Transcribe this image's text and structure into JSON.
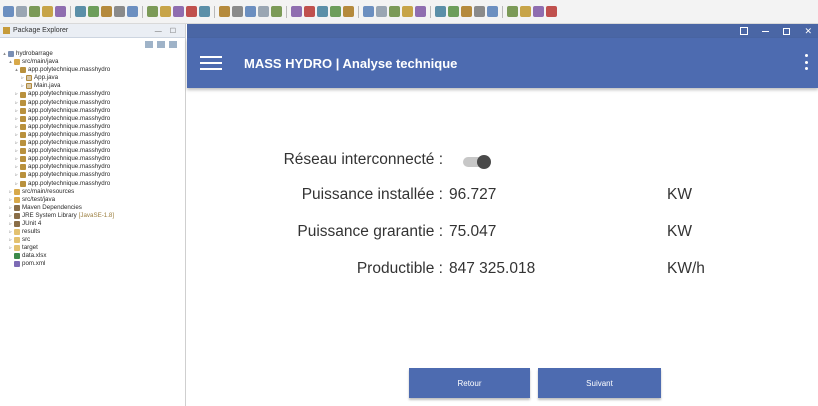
{
  "explorer": {
    "tab_label": "Package Explorer",
    "tab_suffix": "✕✕",
    "tree": [
      {
        "depth": 0,
        "twist": "▴",
        "icon": "project",
        "label": "hydrobarrage"
      },
      {
        "depth": 1,
        "twist": "▴",
        "icon": "srcfolder",
        "label": "src/main/java"
      },
      {
        "depth": 2,
        "twist": "▴",
        "icon": "package",
        "label": "app.polytechnique.masshydro"
      },
      {
        "depth": 3,
        "twist": "▹",
        "icon": "java",
        "label": "App.java"
      },
      {
        "depth": 3,
        "twist": "▹",
        "icon": "java",
        "label": "Main.java"
      },
      {
        "depth": 2,
        "twist": "▹",
        "icon": "package",
        "label": "app.polytechnique.masshydro"
      },
      {
        "depth": 2,
        "twist": "▹",
        "icon": "package",
        "label": "app.polytechnique.masshydro"
      },
      {
        "depth": 2,
        "twist": "▹",
        "icon": "package",
        "label": "app.polytechnique.masshydro"
      },
      {
        "depth": 2,
        "twist": "▹",
        "icon": "package",
        "label": "app.polytechnique.masshydro"
      },
      {
        "depth": 2,
        "twist": "▹",
        "icon": "package",
        "label": "app.polytechnique.masshydro"
      },
      {
        "depth": 2,
        "twist": "▹",
        "icon": "package",
        "label": "app.polytechnique.masshydro"
      },
      {
        "depth": 2,
        "twist": "▹",
        "icon": "package",
        "label": "app.polytechnique.masshydro"
      },
      {
        "depth": 2,
        "twist": "▹",
        "icon": "package",
        "label": "app.polytechnique.masshydro"
      },
      {
        "depth": 2,
        "twist": "▹",
        "icon": "package",
        "label": "app.polytechnique.masshydro"
      },
      {
        "depth": 2,
        "twist": "▹",
        "icon": "package",
        "label": "app.polytechnique.masshydro"
      },
      {
        "depth": 2,
        "twist": "▹",
        "icon": "package",
        "label": "app.polytechnique.masshydro"
      },
      {
        "depth": 2,
        "twist": "▹",
        "icon": "package",
        "label": "app.polytechnique.masshydro"
      },
      {
        "depth": 1,
        "twist": "▹",
        "icon": "srcfolder",
        "label": "src/main/resources"
      },
      {
        "depth": 1,
        "twist": "▹",
        "icon": "srcfolder",
        "label": "src/test/java"
      },
      {
        "depth": 1,
        "twist": "▹",
        "icon": "lib",
        "label": "Maven Dependencies"
      },
      {
        "depth": 1,
        "twist": "▹",
        "icon": "lib",
        "label": "JRE System Library",
        "suffix": "[JavaSE-1.8]"
      },
      {
        "depth": 1,
        "twist": "▹",
        "icon": "lib",
        "label": "JUnit 4"
      },
      {
        "depth": 1,
        "twist": "▹",
        "icon": "folder",
        "label": "results"
      },
      {
        "depth": 1,
        "twist": "▹",
        "icon": "folder",
        "label": "src"
      },
      {
        "depth": 1,
        "twist": "▹",
        "icon": "folder",
        "label": "target"
      },
      {
        "depth": 1,
        "twist": "",
        "icon": "xlsx",
        "label": "data.xlsx"
      },
      {
        "depth": 1,
        "twist": "",
        "icon": "xml",
        "label": "pom.xml"
      }
    ]
  },
  "app": {
    "title": "MASS HYDRO | Analyse technique",
    "network": {
      "label": "Réseau interconnecté :",
      "enabled": false
    },
    "rows": [
      {
        "label": "Puissance installée :",
        "value": "96.727",
        "unit": "KW"
      },
      {
        "label": "Puissance grarantie :",
        "value": "75.047",
        "unit": "KW"
      },
      {
        "label": "Productible :",
        "value": "847 325.018",
        "unit": "KW/h"
      }
    ],
    "buttons": {
      "back": "Retour",
      "next": "Suivant"
    }
  },
  "colors": {
    "primary": "#4d6bb0",
    "status_bar": "#4a66a5",
    "toggle_track": "#c7c7c7",
    "toggle_knob": "#4a4a4a"
  },
  "icons": [
    "menu-icon",
    "more-vert-icon",
    "fullscreen-icon",
    "minimize-icon",
    "maximize-icon",
    "close-icon"
  ]
}
